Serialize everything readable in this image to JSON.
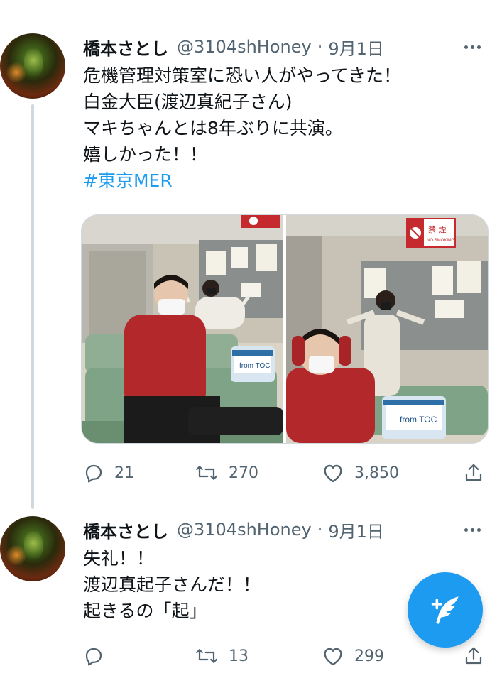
{
  "tweets": [
    {
      "author_name": "橋本さとし",
      "handle": "@3104shHoney",
      "separator": "·",
      "date": "9月1日",
      "text_lines": [
        "危機管理対策室に恐い人がやってきた！",
        "白金大臣(渡辺真紀子さん)",
        "マキちゃんとは8年ぶりに共演。",
        "嬉しかった！！"
      ],
      "hashtag": "#東京MER",
      "media": {
        "left_photo": {
          "sign_text": "",
          "bag_text": "from TOC"
        },
        "right_photo": {
          "sign_text": "禁 煙",
          "sign_sub": "NO SMOKING",
          "bag_text": "from TOC"
        }
      },
      "replies": "21",
      "retweets": "270",
      "likes": "3,850"
    },
    {
      "author_name": "橋本さとし",
      "handle": "@3104shHoney",
      "separator": "·",
      "date": "9月1日",
      "text_lines": [
        "失礼！！",
        "渡辺真起子さんだ！！",
        "起きるの「起」"
      ],
      "replies": "",
      "retweets": "13",
      "likes": "299"
    }
  ],
  "icons": {
    "reply": "reply-icon",
    "retweet": "retweet-icon",
    "like": "heart-icon",
    "share": "share-icon",
    "compose": "compose-tweet-icon",
    "more": "more-horizontal-icon"
  },
  "colors": {
    "accent": "#1d9bf0",
    "muted": "#536471",
    "text": "#0f1419",
    "divider": "#eff3f4"
  }
}
